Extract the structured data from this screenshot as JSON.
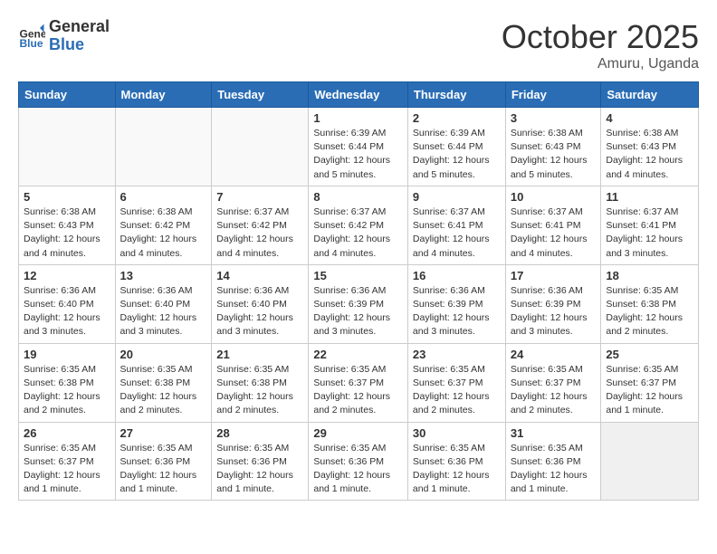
{
  "header": {
    "logo_general": "General",
    "logo_blue": "Blue",
    "title": "October 2025",
    "location": "Amuru, Uganda"
  },
  "weekdays": [
    "Sunday",
    "Monday",
    "Tuesday",
    "Wednesday",
    "Thursday",
    "Friday",
    "Saturday"
  ],
  "weeks": [
    [
      {
        "day": "",
        "info": "",
        "empty": true
      },
      {
        "day": "",
        "info": "",
        "empty": true
      },
      {
        "day": "",
        "info": "",
        "empty": true
      },
      {
        "day": "1",
        "info": "Sunrise: 6:39 AM\nSunset: 6:44 PM\nDaylight: 12 hours\nand 5 minutes."
      },
      {
        "day": "2",
        "info": "Sunrise: 6:39 AM\nSunset: 6:44 PM\nDaylight: 12 hours\nand 5 minutes."
      },
      {
        "day": "3",
        "info": "Sunrise: 6:38 AM\nSunset: 6:43 PM\nDaylight: 12 hours\nand 5 minutes."
      },
      {
        "day": "4",
        "info": "Sunrise: 6:38 AM\nSunset: 6:43 PM\nDaylight: 12 hours\nand 4 minutes."
      }
    ],
    [
      {
        "day": "5",
        "info": "Sunrise: 6:38 AM\nSunset: 6:43 PM\nDaylight: 12 hours\nand 4 minutes."
      },
      {
        "day": "6",
        "info": "Sunrise: 6:38 AM\nSunset: 6:42 PM\nDaylight: 12 hours\nand 4 minutes."
      },
      {
        "day": "7",
        "info": "Sunrise: 6:37 AM\nSunset: 6:42 PM\nDaylight: 12 hours\nand 4 minutes."
      },
      {
        "day": "8",
        "info": "Sunrise: 6:37 AM\nSunset: 6:42 PM\nDaylight: 12 hours\nand 4 minutes."
      },
      {
        "day": "9",
        "info": "Sunrise: 6:37 AM\nSunset: 6:41 PM\nDaylight: 12 hours\nand 4 minutes."
      },
      {
        "day": "10",
        "info": "Sunrise: 6:37 AM\nSunset: 6:41 PM\nDaylight: 12 hours\nand 4 minutes."
      },
      {
        "day": "11",
        "info": "Sunrise: 6:37 AM\nSunset: 6:41 PM\nDaylight: 12 hours\nand 3 minutes."
      }
    ],
    [
      {
        "day": "12",
        "info": "Sunrise: 6:36 AM\nSunset: 6:40 PM\nDaylight: 12 hours\nand 3 minutes."
      },
      {
        "day": "13",
        "info": "Sunrise: 6:36 AM\nSunset: 6:40 PM\nDaylight: 12 hours\nand 3 minutes."
      },
      {
        "day": "14",
        "info": "Sunrise: 6:36 AM\nSunset: 6:40 PM\nDaylight: 12 hours\nand 3 minutes."
      },
      {
        "day": "15",
        "info": "Sunrise: 6:36 AM\nSunset: 6:39 PM\nDaylight: 12 hours\nand 3 minutes."
      },
      {
        "day": "16",
        "info": "Sunrise: 6:36 AM\nSunset: 6:39 PM\nDaylight: 12 hours\nand 3 minutes."
      },
      {
        "day": "17",
        "info": "Sunrise: 6:36 AM\nSunset: 6:39 PM\nDaylight: 12 hours\nand 3 minutes."
      },
      {
        "day": "18",
        "info": "Sunrise: 6:35 AM\nSunset: 6:38 PM\nDaylight: 12 hours\nand 2 minutes."
      }
    ],
    [
      {
        "day": "19",
        "info": "Sunrise: 6:35 AM\nSunset: 6:38 PM\nDaylight: 12 hours\nand 2 minutes."
      },
      {
        "day": "20",
        "info": "Sunrise: 6:35 AM\nSunset: 6:38 PM\nDaylight: 12 hours\nand 2 minutes."
      },
      {
        "day": "21",
        "info": "Sunrise: 6:35 AM\nSunset: 6:38 PM\nDaylight: 12 hours\nand 2 minutes."
      },
      {
        "day": "22",
        "info": "Sunrise: 6:35 AM\nSunset: 6:37 PM\nDaylight: 12 hours\nand 2 minutes."
      },
      {
        "day": "23",
        "info": "Sunrise: 6:35 AM\nSunset: 6:37 PM\nDaylight: 12 hours\nand 2 minutes."
      },
      {
        "day": "24",
        "info": "Sunrise: 6:35 AM\nSunset: 6:37 PM\nDaylight: 12 hours\nand 2 minutes."
      },
      {
        "day": "25",
        "info": "Sunrise: 6:35 AM\nSunset: 6:37 PM\nDaylight: 12 hours\nand 1 minute."
      }
    ],
    [
      {
        "day": "26",
        "info": "Sunrise: 6:35 AM\nSunset: 6:37 PM\nDaylight: 12 hours\nand 1 minute."
      },
      {
        "day": "27",
        "info": "Sunrise: 6:35 AM\nSunset: 6:36 PM\nDaylight: 12 hours\nand 1 minute."
      },
      {
        "day": "28",
        "info": "Sunrise: 6:35 AM\nSunset: 6:36 PM\nDaylight: 12 hours\nand 1 minute."
      },
      {
        "day": "29",
        "info": "Sunrise: 6:35 AM\nSunset: 6:36 PM\nDaylight: 12 hours\nand 1 minute."
      },
      {
        "day": "30",
        "info": "Sunrise: 6:35 AM\nSunset: 6:36 PM\nDaylight: 12 hours\nand 1 minute."
      },
      {
        "day": "31",
        "info": "Sunrise: 6:35 AM\nSunset: 6:36 PM\nDaylight: 12 hours\nand 1 minute."
      },
      {
        "day": "",
        "info": "",
        "empty": true,
        "shaded": true
      }
    ]
  ]
}
